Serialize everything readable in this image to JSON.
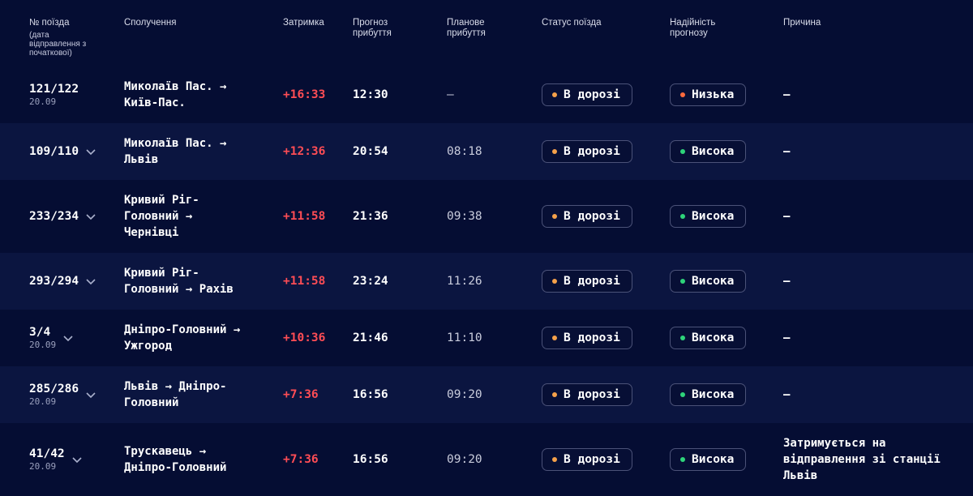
{
  "header": {
    "train": "№ поїзда",
    "train_sub": "(дата відправлення з початкової)",
    "route": "Сполучення",
    "delay": "Затримка",
    "forecast": "Прогноз прибуття",
    "planned": "Планове прибуття",
    "status": "Статус поїзда",
    "reliability": "Надійність прогнозу",
    "reason": "Причина"
  },
  "colors": {
    "background": "#050d33",
    "row_alt": "#0b1540",
    "delay": "#ff4d55",
    "status_dot": "#f5a14a",
    "low_dot": "#ff6a3d",
    "high_dot": "#2ed47a"
  },
  "rows": [
    {
      "train": "121/122",
      "date": "20.09",
      "expand": false,
      "route": "Миколаїв Пас. →\nКиїв-Пас.",
      "delay": "+16:33",
      "forecast": "12:30",
      "planned": "—",
      "status": "В дорозі",
      "reliability": "Низька",
      "reliability_level": "low",
      "reason": "—"
    },
    {
      "train": "109/110",
      "date": "",
      "expand": true,
      "route": "Миколаїв Пас. →\nЛьвів",
      "delay": "+12:36",
      "forecast": "20:54",
      "planned": "08:18",
      "status": "В дорозі",
      "reliability": "Висока",
      "reliability_level": "high",
      "reason": "—"
    },
    {
      "train": "233/234",
      "date": "",
      "expand": true,
      "route": "Кривий Ріг-\nГоловний →\nЧернівці",
      "delay": "+11:58",
      "forecast": "21:36",
      "planned": "09:38",
      "status": "В дорозі",
      "reliability": "Висока",
      "reliability_level": "high",
      "reason": "—"
    },
    {
      "train": "293/294",
      "date": "",
      "expand": true,
      "route": "Кривий Ріг-\nГоловний →  Рахів",
      "delay": "+11:58",
      "forecast": "23:24",
      "planned": "11:26",
      "status": "В дорозі",
      "reliability": "Висока",
      "reliability_level": "high",
      "reason": "—"
    },
    {
      "train": "3/4",
      "date": "20.09",
      "expand": true,
      "route": "Дніпро-Головний →\nУжгород",
      "delay": "+10:36",
      "forecast": "21:46",
      "planned": "11:10",
      "status": "В дорозі",
      "reliability": "Висока",
      "reliability_level": "high",
      "reason": "—"
    },
    {
      "train": "285/286",
      "date": "20.09",
      "expand": true,
      "route": "Львів →  Дніпро-\nГоловний",
      "delay": "+7:36",
      "forecast": "16:56",
      "planned": "09:20",
      "status": "В дорозі",
      "reliability": "Висока",
      "reliability_level": "high",
      "reason": "—"
    },
    {
      "train": "41/42",
      "date": "20.09",
      "expand": true,
      "route": "Трускавець →\nДніпро-Головний",
      "delay": "+7:36",
      "forecast": "16:56",
      "planned": "09:20",
      "status": "В дорозі",
      "reliability": "Висока",
      "reliability_level": "high",
      "reason": "Затримується на\nвідправлення зі станції\nЛьвів"
    }
  ]
}
